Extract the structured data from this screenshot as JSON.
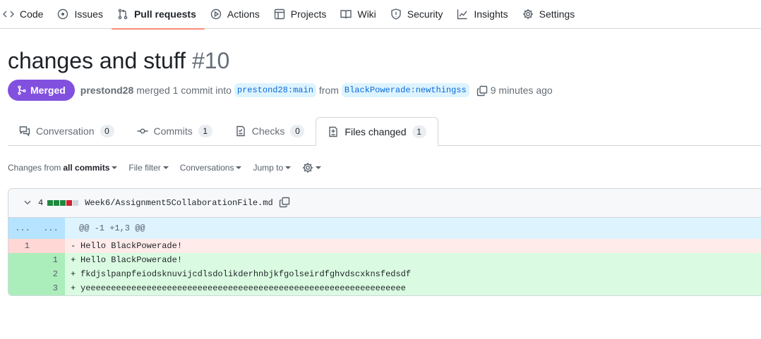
{
  "nav": {
    "items": [
      {
        "label": "Code",
        "icon": "code-icon"
      },
      {
        "label": "Issues",
        "icon": "issue-opened-icon"
      },
      {
        "label": "Pull requests",
        "icon": "git-pull-request-icon",
        "active": true
      },
      {
        "label": "Actions",
        "icon": "play-icon"
      },
      {
        "label": "Projects",
        "icon": "table-icon"
      },
      {
        "label": "Wiki",
        "icon": "book-icon"
      },
      {
        "label": "Security",
        "icon": "shield-icon"
      },
      {
        "label": "Insights",
        "icon": "graph-icon"
      },
      {
        "label": "Settings",
        "icon": "gear-icon"
      }
    ],
    "active_color": "#fd8c73"
  },
  "pr": {
    "title": "changes and stuff",
    "number": "#10",
    "state": "Merged",
    "state_color": "#8250df",
    "author": "prestond28",
    "action_text": "merged 1 commit into",
    "base_branch": "prestond28:main",
    "from_text": "from",
    "head_branch": "BlackPowerade:newthingss",
    "time_ago": "9 minutes ago"
  },
  "tabs": [
    {
      "label": "Conversation",
      "count": "0",
      "icon": "comment-discussion-icon"
    },
    {
      "label": "Commits",
      "count": "1",
      "icon": "git-commit-icon"
    },
    {
      "label": "Checks",
      "count": "0",
      "icon": "checklist-icon"
    },
    {
      "label": "Files changed",
      "count": "1",
      "icon": "file-diff-icon",
      "active": true
    }
  ],
  "toolbar": {
    "changes_from_label": "Changes from",
    "changes_from_value": "all commits",
    "file_filter": "File filter",
    "conversations": "Conversations",
    "jump_to": "Jump to"
  },
  "file": {
    "changes": "4",
    "diffstat": [
      "added",
      "added",
      "added",
      "deleted",
      "neutral"
    ],
    "diffstat_colors": {
      "added": "#1f883d",
      "deleted": "#cf222e",
      "neutral": "#d0d7de"
    },
    "path": "Week6/Assignment5CollaborationFile.md",
    "hunk": {
      "left": "...",
      "right": "...",
      "header": "@@ -1 +1,3 @@"
    },
    "lines": [
      {
        "type": "del",
        "old": "1",
        "new": "",
        "marker": "-",
        "text": "Hello BlackPowerade!"
      },
      {
        "type": "add",
        "old": "",
        "new": "1",
        "marker": "+",
        "text": "Hello BlackPowerade!"
      },
      {
        "type": "add",
        "old": "",
        "new": "2",
        "marker": "+",
        "text": "fkdjslpanpfeiodsknuvijcdlsdolikderhnbjkfgolseirdfghvdscxknsfedsdf"
      },
      {
        "type": "add",
        "old": "",
        "new": "3",
        "marker": "+",
        "text": "yeeeeeeeeeeeeeeeeeeeeeeeeeeeeeeeeeeeeeeeeeeeeeeeeeeeeeeeeeeeeeee"
      }
    ]
  }
}
